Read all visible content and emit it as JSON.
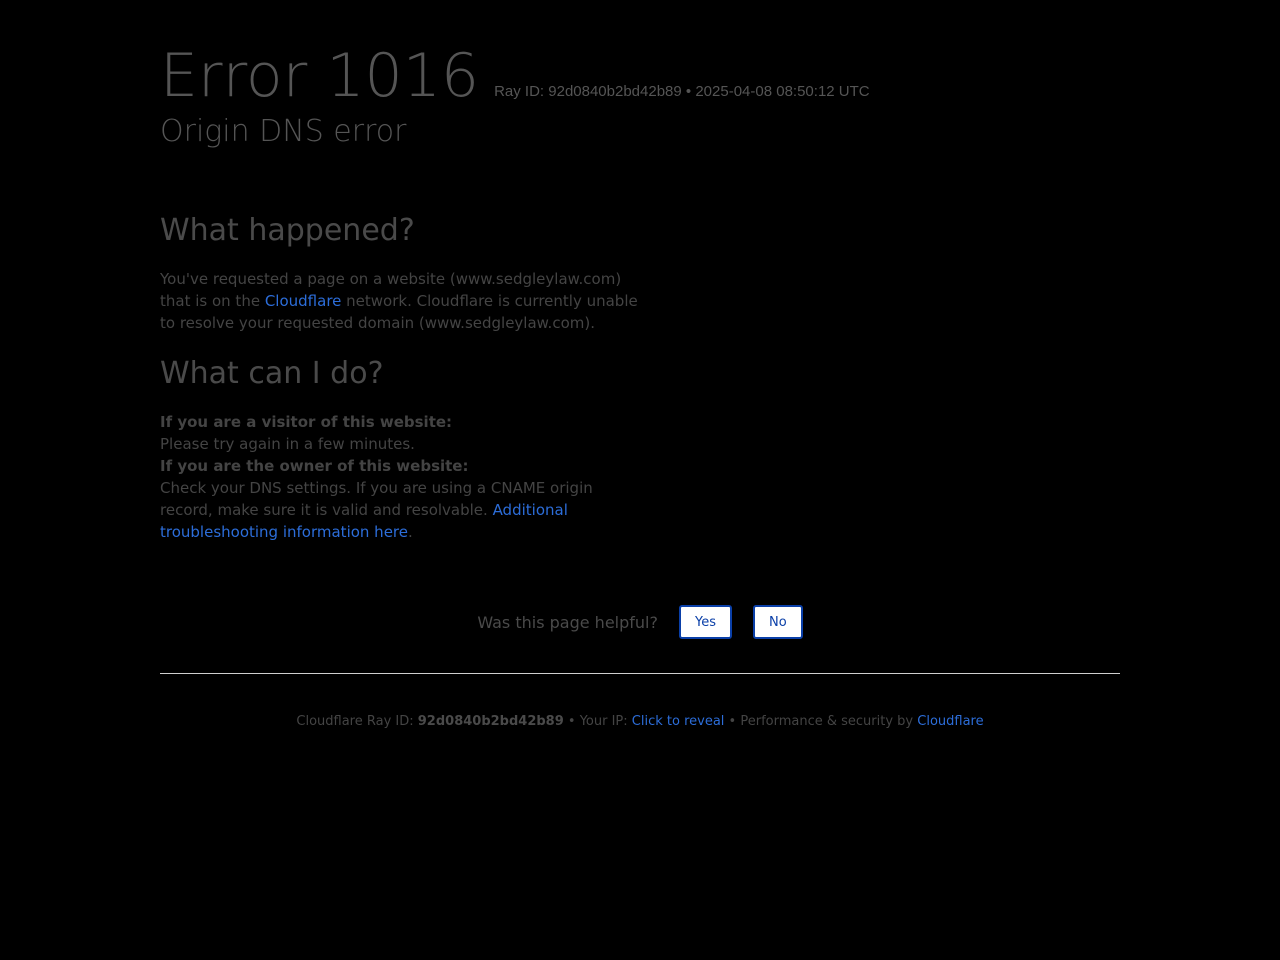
{
  "header": {
    "error_code": "Error 1016",
    "ray_id_label": "Ray ID: 92d0840b2bd42b89",
    "separator": "•",
    "timestamp": "2025-04-08 08:50:12 UTC",
    "subtitle": "Origin DNS error"
  },
  "what_happened": {
    "heading": "What happened?",
    "text_before_link": "You've requested a page on a website (www.sedgleylaw.com) that is on the ",
    "link_text": "Cloudflare",
    "text_after_link": " network. Cloudflare is currently unable to resolve your requested domain (www.sedgleylaw.com)."
  },
  "what_can_i_do": {
    "heading": "What can I do?",
    "visitor_label": "If you are a visitor of this website:",
    "visitor_text": "Please try again in a few minutes.",
    "owner_label": "If you are the owner of this website:",
    "owner_text": "Check your DNS settings. If you are using a CNAME origin record, make sure it is valid and resolvable. ",
    "owner_link": "Additional troubleshooting information here",
    "owner_link_suffix": "."
  },
  "feedback": {
    "question": "Was this page helpful?",
    "yes_label": "Yes",
    "no_label": "No"
  },
  "footer": {
    "ray_label": "Cloudflare Ray ID: ",
    "ray_id": "92d0840b2bd42b89",
    "sep1": " • ",
    "ip_label": "Your IP: ",
    "ip_link": "Click to reveal",
    "sep2": " • ",
    "perf_label": "Performance & security by ",
    "perf_link": "Cloudflare"
  },
  "colors": {
    "background": "#000000",
    "link": "#2c6dd9",
    "button_border": "#0a3fa8"
  }
}
